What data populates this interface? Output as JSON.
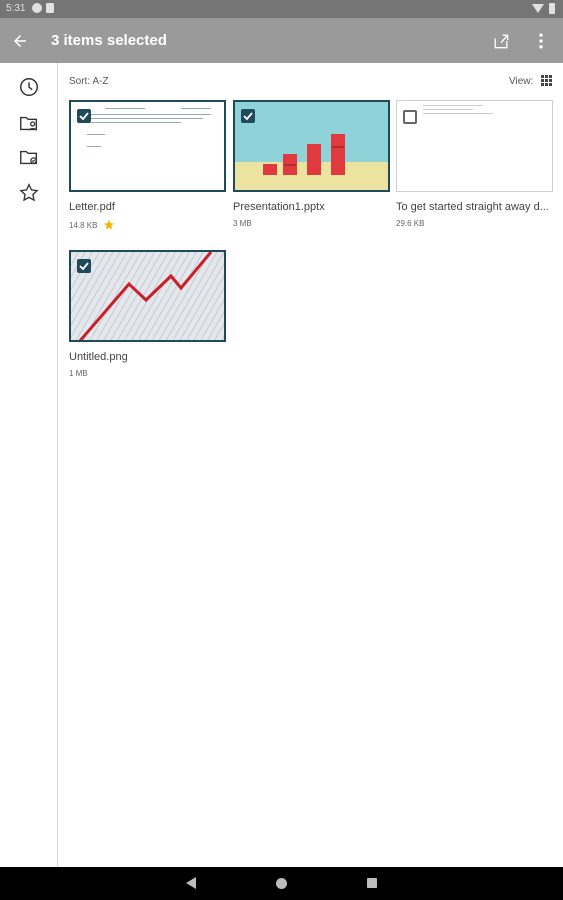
{
  "status_bar": {
    "time": "5:31"
  },
  "app_bar": {
    "title": "3 items selected",
    "icons": {
      "back": "arrow-back-icon",
      "share": "share-icon",
      "more": "more-vert-icon"
    }
  },
  "side_rail": {
    "items": [
      {
        "icon": "recent-clock-icon"
      },
      {
        "icon": "shared-folder-icon"
      },
      {
        "icon": "offline-folder-icon"
      },
      {
        "icon": "starred-icon"
      }
    ]
  },
  "toolbar": {
    "sort_label": "Sort: A-Z",
    "view_label": "View:"
  },
  "files": [
    {
      "name": "Letter.pdf",
      "size": "14.8 KB",
      "starred": true,
      "selected": true
    },
    {
      "name": "Presentation1.pptx",
      "size": "3 MB",
      "starred": false,
      "selected": true
    },
    {
      "name": "To get started straight away d...",
      "size": "29.6 KB",
      "starred": false,
      "selected": false
    },
    {
      "name": "Untitled.png",
      "size": "1 MB",
      "starred": false,
      "selected": true
    }
  ],
  "colors": {
    "app_bar": "#9a9a9a",
    "selection": "#1f4a5a",
    "star": "#f2b705",
    "bar_red": "#e0393e",
    "slide_bg": "#8fd3d8",
    "slide_floor": "#ece3a0",
    "chart_line": "#c9202a"
  }
}
